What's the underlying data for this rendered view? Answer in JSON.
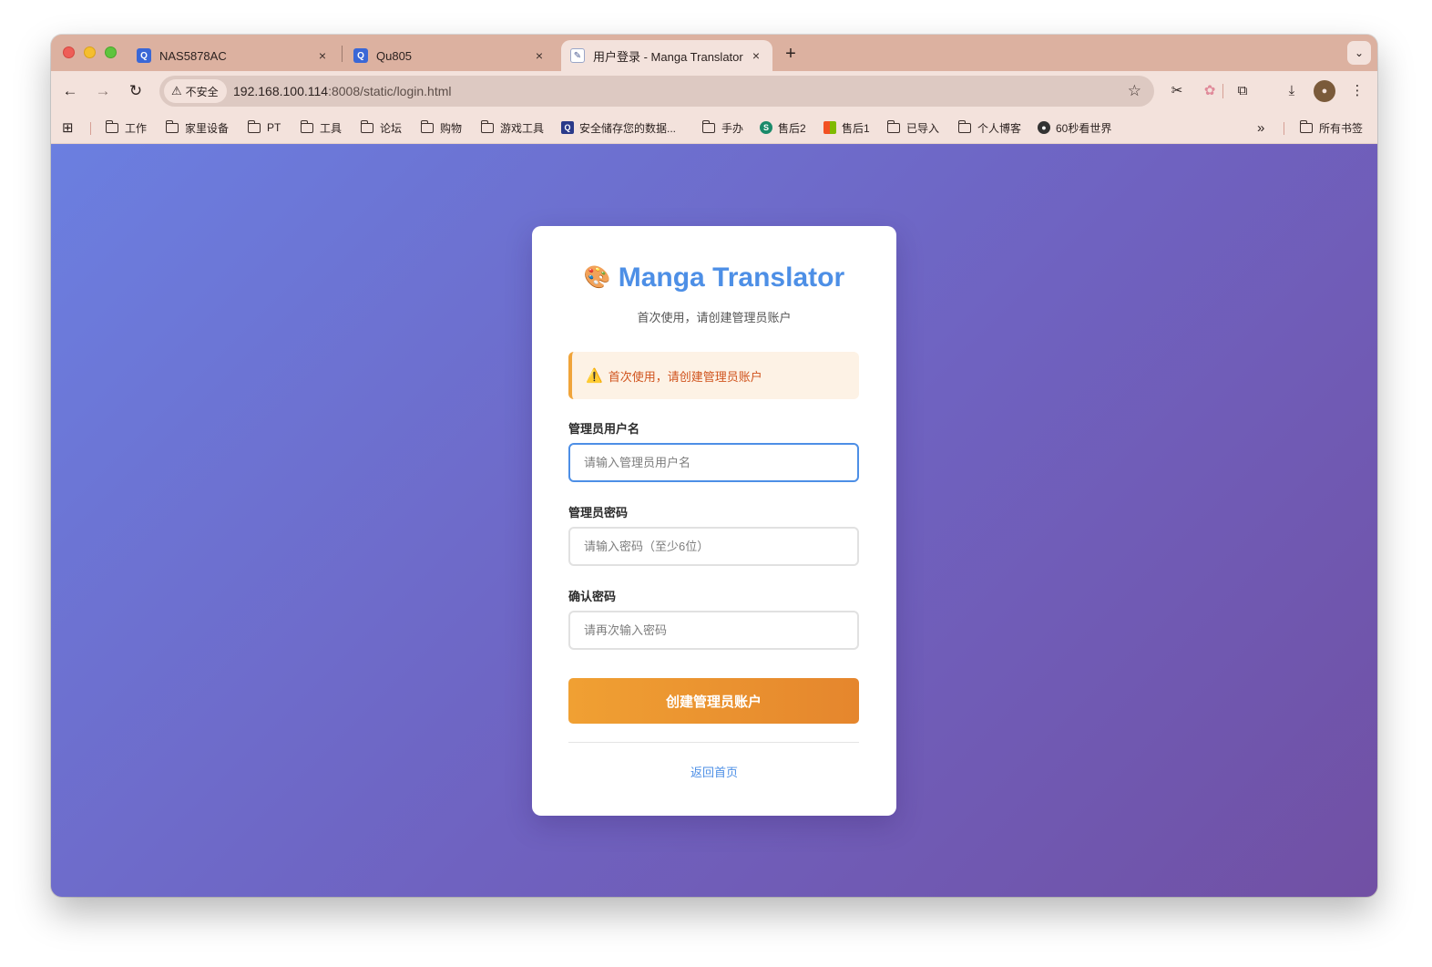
{
  "browser": {
    "tabs": [
      {
        "title": "NAS5878AC",
        "favicon": "qnap-icon"
      },
      {
        "title": "Qu805",
        "favicon": "qnap-icon"
      },
      {
        "title": "用户登录 - Manga Translator",
        "favicon": "translator-icon",
        "active": true
      }
    ],
    "tab_close": "×",
    "new_tab": "+",
    "security_label": "不安全",
    "url_host": "192.168.100.114",
    "url_rest": ":8008/static/login.html",
    "bookmarks": [
      {
        "label": "工作",
        "icon": "folder-icon"
      },
      {
        "label": "家里设备",
        "icon": "folder-icon"
      },
      {
        "label": "PT",
        "icon": "folder-icon"
      },
      {
        "label": "工具",
        "icon": "folder-icon"
      },
      {
        "label": "论坛",
        "icon": "folder-icon"
      },
      {
        "label": "购物",
        "icon": "folder-icon"
      },
      {
        "label": "游戏工具",
        "icon": "folder-icon"
      },
      {
        "label": "安全储存您的数据...",
        "icon": "site-icon"
      },
      {
        "label": "手办",
        "icon": "folder-icon"
      },
      {
        "label": "售后2",
        "icon": "site-icon"
      },
      {
        "label": "售后1",
        "icon": "microsoft-icon"
      },
      {
        "label": "已导入",
        "icon": "folder-icon"
      },
      {
        "label": "个人博客",
        "icon": "folder-icon"
      },
      {
        "label": "60秒看世界",
        "icon": "site-icon"
      }
    ],
    "bookmarks_overflow": "»",
    "all_bookmarks": "所有书签"
  },
  "page": {
    "title": "Manga Translator",
    "subtitle": "首次使用，请创建管理员账户",
    "alert": "首次使用，请创建管理员账户",
    "username_label": "管理员用户名",
    "username_placeholder": "请输入管理员用户名",
    "password_label": "管理员密码",
    "password_placeholder": "请输入密码（至少6位）",
    "confirm_label": "确认密码",
    "confirm_placeholder": "请再次输入密码",
    "submit_label": "创建管理员账户",
    "back_link": "返回首页"
  },
  "colors": {
    "accent": "#4d8fe6",
    "button": "#e8902f",
    "alert_text": "#d0541e",
    "gradient_start": "#6b7fe0",
    "gradient_end": "#7150a4"
  }
}
